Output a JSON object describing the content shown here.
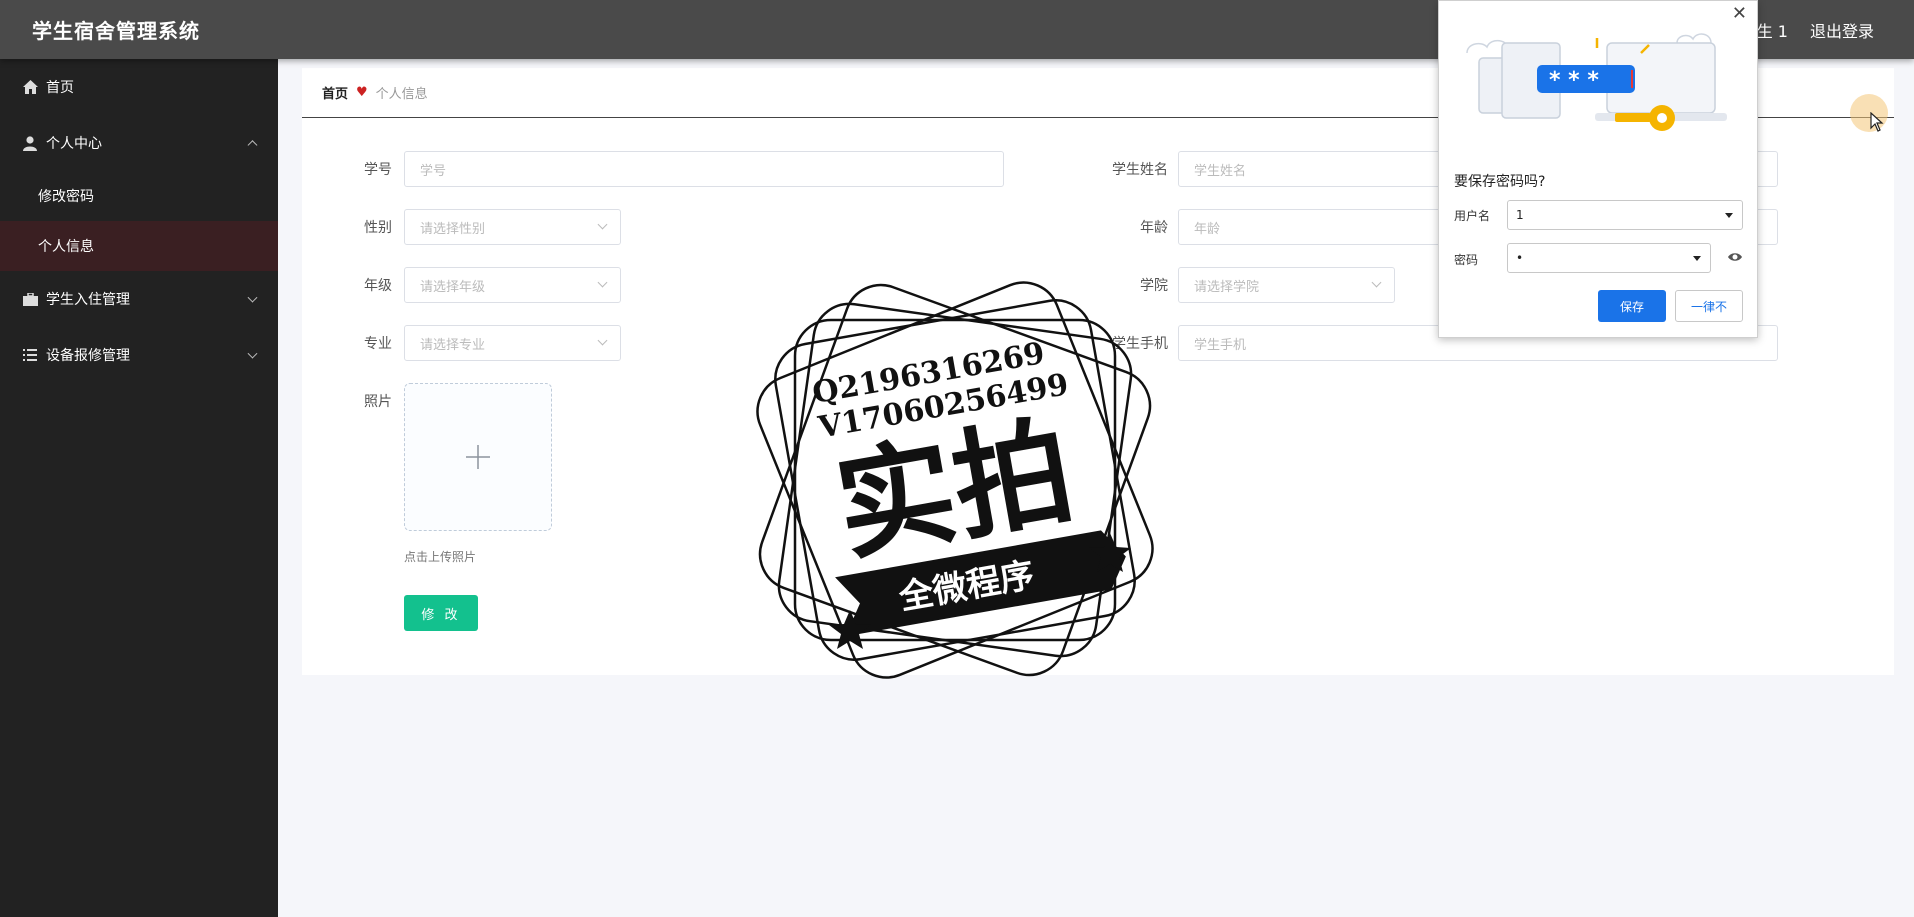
{
  "header": {
    "title": "学生宿舍管理系统",
    "user_label": "生 1",
    "logout_label": "退出登录"
  },
  "sidebar": {
    "items": [
      {
        "label": "首页",
        "icon": "home-icon"
      },
      {
        "label": "个人中心",
        "icon": "user-icon",
        "expanded": true,
        "children": [
          {
            "label": "修改密码"
          },
          {
            "label": "个人信息",
            "active": true
          }
        ]
      },
      {
        "label": "学生入住管理",
        "icon": "briefcase-icon"
      },
      {
        "label": "设备报修管理",
        "icon": "list-icon"
      }
    ]
  },
  "breadcrumb": {
    "home": "首页",
    "separator": "♥",
    "current": "个人信息"
  },
  "form": {
    "student_no": {
      "label": "学号",
      "placeholder": "学号"
    },
    "student_name": {
      "label": "学生姓名",
      "placeholder": "学生姓名"
    },
    "gender": {
      "label": "性别",
      "placeholder": "请选择性别"
    },
    "age": {
      "label": "年龄",
      "placeholder": "年龄"
    },
    "grade": {
      "label": "年级",
      "placeholder": "请选择年级"
    },
    "college": {
      "label": "学院",
      "placeholder": "请选择学院"
    },
    "major": {
      "label": "专业",
      "placeholder": "请选择专业"
    },
    "phone": {
      "label": "学生手机",
      "placeholder": "学生手机"
    },
    "photo": {
      "label": "照片",
      "tip": "点击上传照片"
    },
    "submit_label": "修 改"
  },
  "watermark": {
    "line1": "Q2196316269",
    "line2": "V17060256499",
    "main": "实拍",
    "banner": "全微程序"
  },
  "password_popup": {
    "question": "要保存密码吗?",
    "username_label": "用户名",
    "username_value": "1",
    "password_label": "密码",
    "password_value": "•",
    "illustration_text": "* * *",
    "save_label": "保存",
    "never_label": "一律不",
    "accent": "#1a73e8"
  },
  "colors": {
    "header_bg": "#4a4a4a",
    "sidebar_bg": "#222222",
    "active_bg": "#3a1f22",
    "primary_button": "#13c18e"
  }
}
